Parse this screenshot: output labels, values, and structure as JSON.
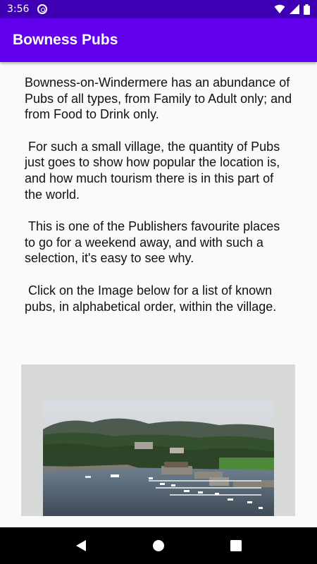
{
  "status_bar": {
    "time": "3:56",
    "icons": [
      "notification-icon",
      "wifi-icon",
      "cell-signal-icon",
      "battery-icon"
    ]
  },
  "app_bar": {
    "title": "Bowness Pubs",
    "color": "#6200ee"
  },
  "content": {
    "paragraphs": [
      "Bowness-on-Windermere has an abundance of Pubs of all types, from Family to Adult only; and from Food to Drink only.",
      " For such a small village, the quantity of Pubs just goes to show how popular the location is, and how much tourism there is in this part of the world.",
      " This is one of the Publishers favourite places to go for a weekend away, and with such a selection, it's easy to see why.",
      " Click on the Image below for a list of known pubs, in alphabetical order, within the village."
    ],
    "image": {
      "subject": "aerial view of Bowness-on-Windermere lakeside with marina and boats",
      "interactive": true
    }
  },
  "nav_bar": {
    "buttons": [
      "back-icon",
      "home-icon",
      "recents-icon"
    ]
  }
}
